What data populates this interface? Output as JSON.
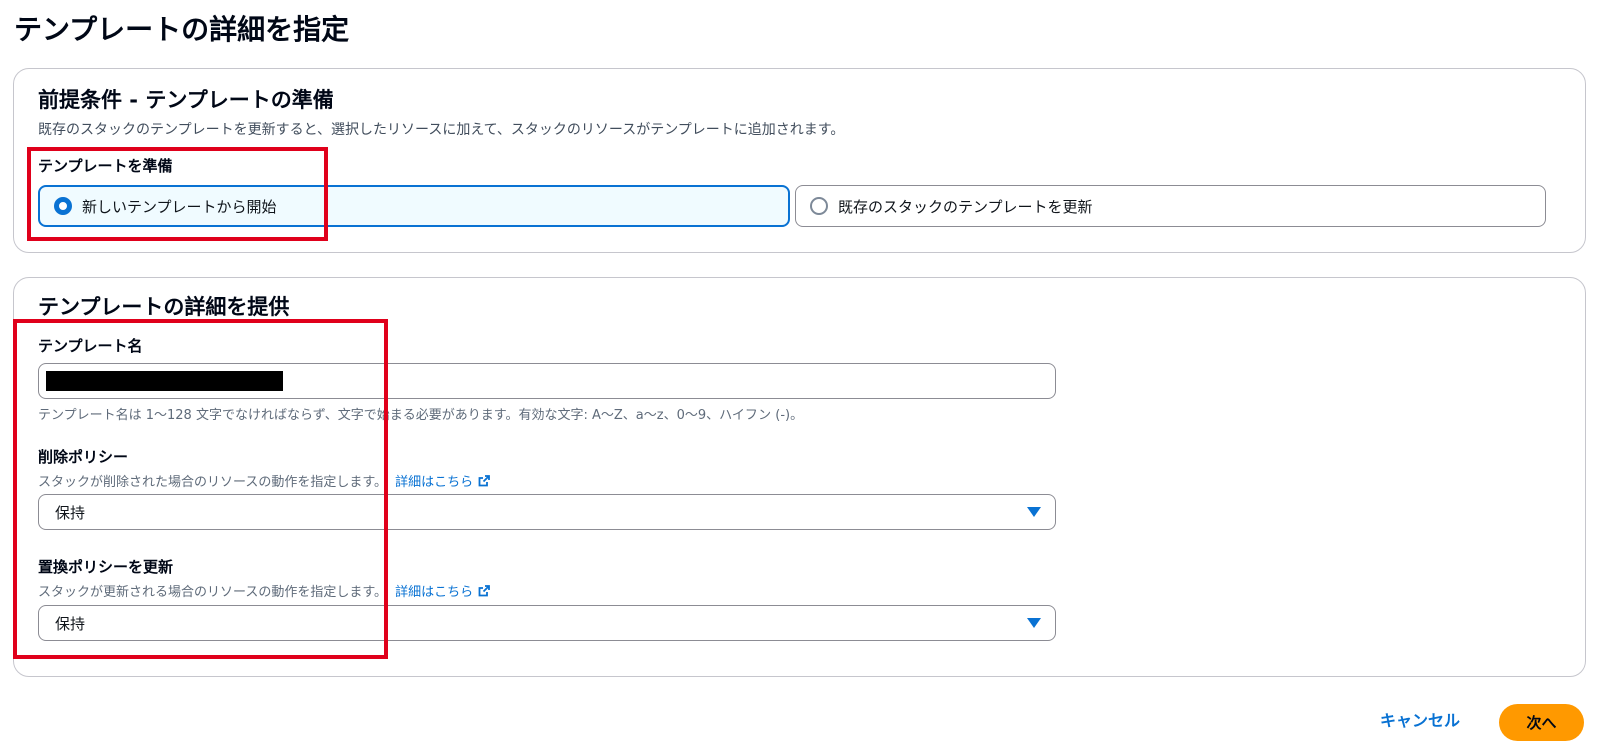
{
  "page": {
    "title": "テンプレートの詳細を指定"
  },
  "prerequisite": {
    "heading": "前提条件 - テンプレートの準備",
    "description": "既存のスタックのテンプレートを更新すると、選択したリソースに加えて、スタックのリソースがテンプレートに追加されます。",
    "prepare_label": "テンプレートを準備",
    "options": [
      {
        "label": "新しいテンプレートから開始",
        "selected": true
      },
      {
        "label": "既存のスタックのテンプレートを更新",
        "selected": false
      }
    ]
  },
  "details": {
    "heading": "テンプレートの詳細を提供",
    "template_name": {
      "label": "テンプレート名",
      "constraint": "テンプレート名は 1〜128 文字でなければならず、文字で始まる必要があります。有効な文字: A〜Z、a〜z、0〜9、ハイフン (-)。"
    },
    "deletion_policy": {
      "label": "削除ポリシー",
      "description": "スタックが削除された場合のリソースの動作を指定します。",
      "learn_more": "詳細はこちら",
      "value": "保持"
    },
    "update_replace_policy": {
      "label": "置換ポリシーを更新",
      "description": "スタックが更新される場合のリソースの動作を指定します。",
      "learn_more": "詳細はこちら",
      "value": "保持"
    }
  },
  "footer": {
    "cancel_label": "キャンセル",
    "next_label": "次へ"
  },
  "colors": {
    "accent": "#0972d3",
    "primary_button": "#ff9900",
    "highlight": "#e0001b"
  }
}
